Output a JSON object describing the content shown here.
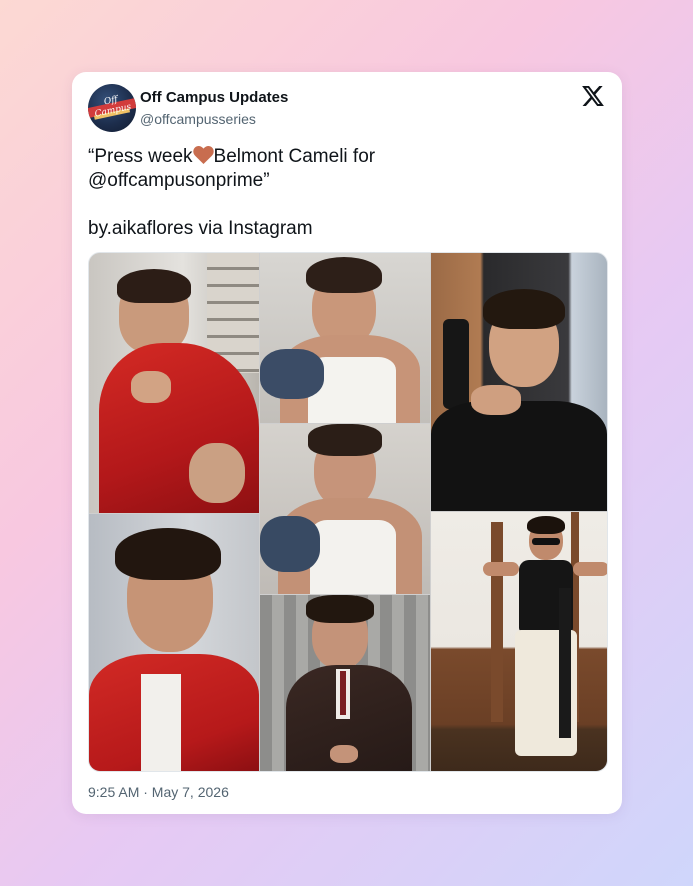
{
  "tweet": {
    "display_name": "Off Campus Updates",
    "handle": "@offcampusseries",
    "avatar_text": "Off Campus",
    "text_line1_pre": "“Press week",
    "text_line1_post": "Belmont Cameli for",
    "text_line2": "@offcampusonprime”",
    "text_line3": "by.aikaflores via Instagram",
    "timestamp": "9:25 AM · May 7, 2026",
    "emoji": "heart-icon",
    "brand_icon": "x-logo-icon"
  },
  "media": {
    "photos": [
      {
        "name": "photo-red-jacket-pointing",
        "subject": "man in red jacket pointing at camera"
      },
      {
        "name": "photo-white-tank-smiling",
        "subject": "man in white tank top smiling"
      },
      {
        "name": "photo-black-tee-pose",
        "subject": "man in black t-shirt posing with hand under chin"
      },
      {
        "name": "photo-white-tank-looking-down",
        "subject": "man in white tank top looking down"
      },
      {
        "name": "photo-red-jacket-portrait",
        "subject": "man in red jacket portrait"
      },
      {
        "name": "photo-brown-suit",
        "subject": "man in brown double-breasted suit"
      },
      {
        "name": "photo-flexing-sunglasses",
        "subject": "man in sunglasses flexing arms"
      }
    ]
  },
  "colors": {
    "text_primary": "#0f1419",
    "text_secondary": "#536471",
    "heart": "#c86d4f",
    "card_bg": "#ffffff"
  }
}
